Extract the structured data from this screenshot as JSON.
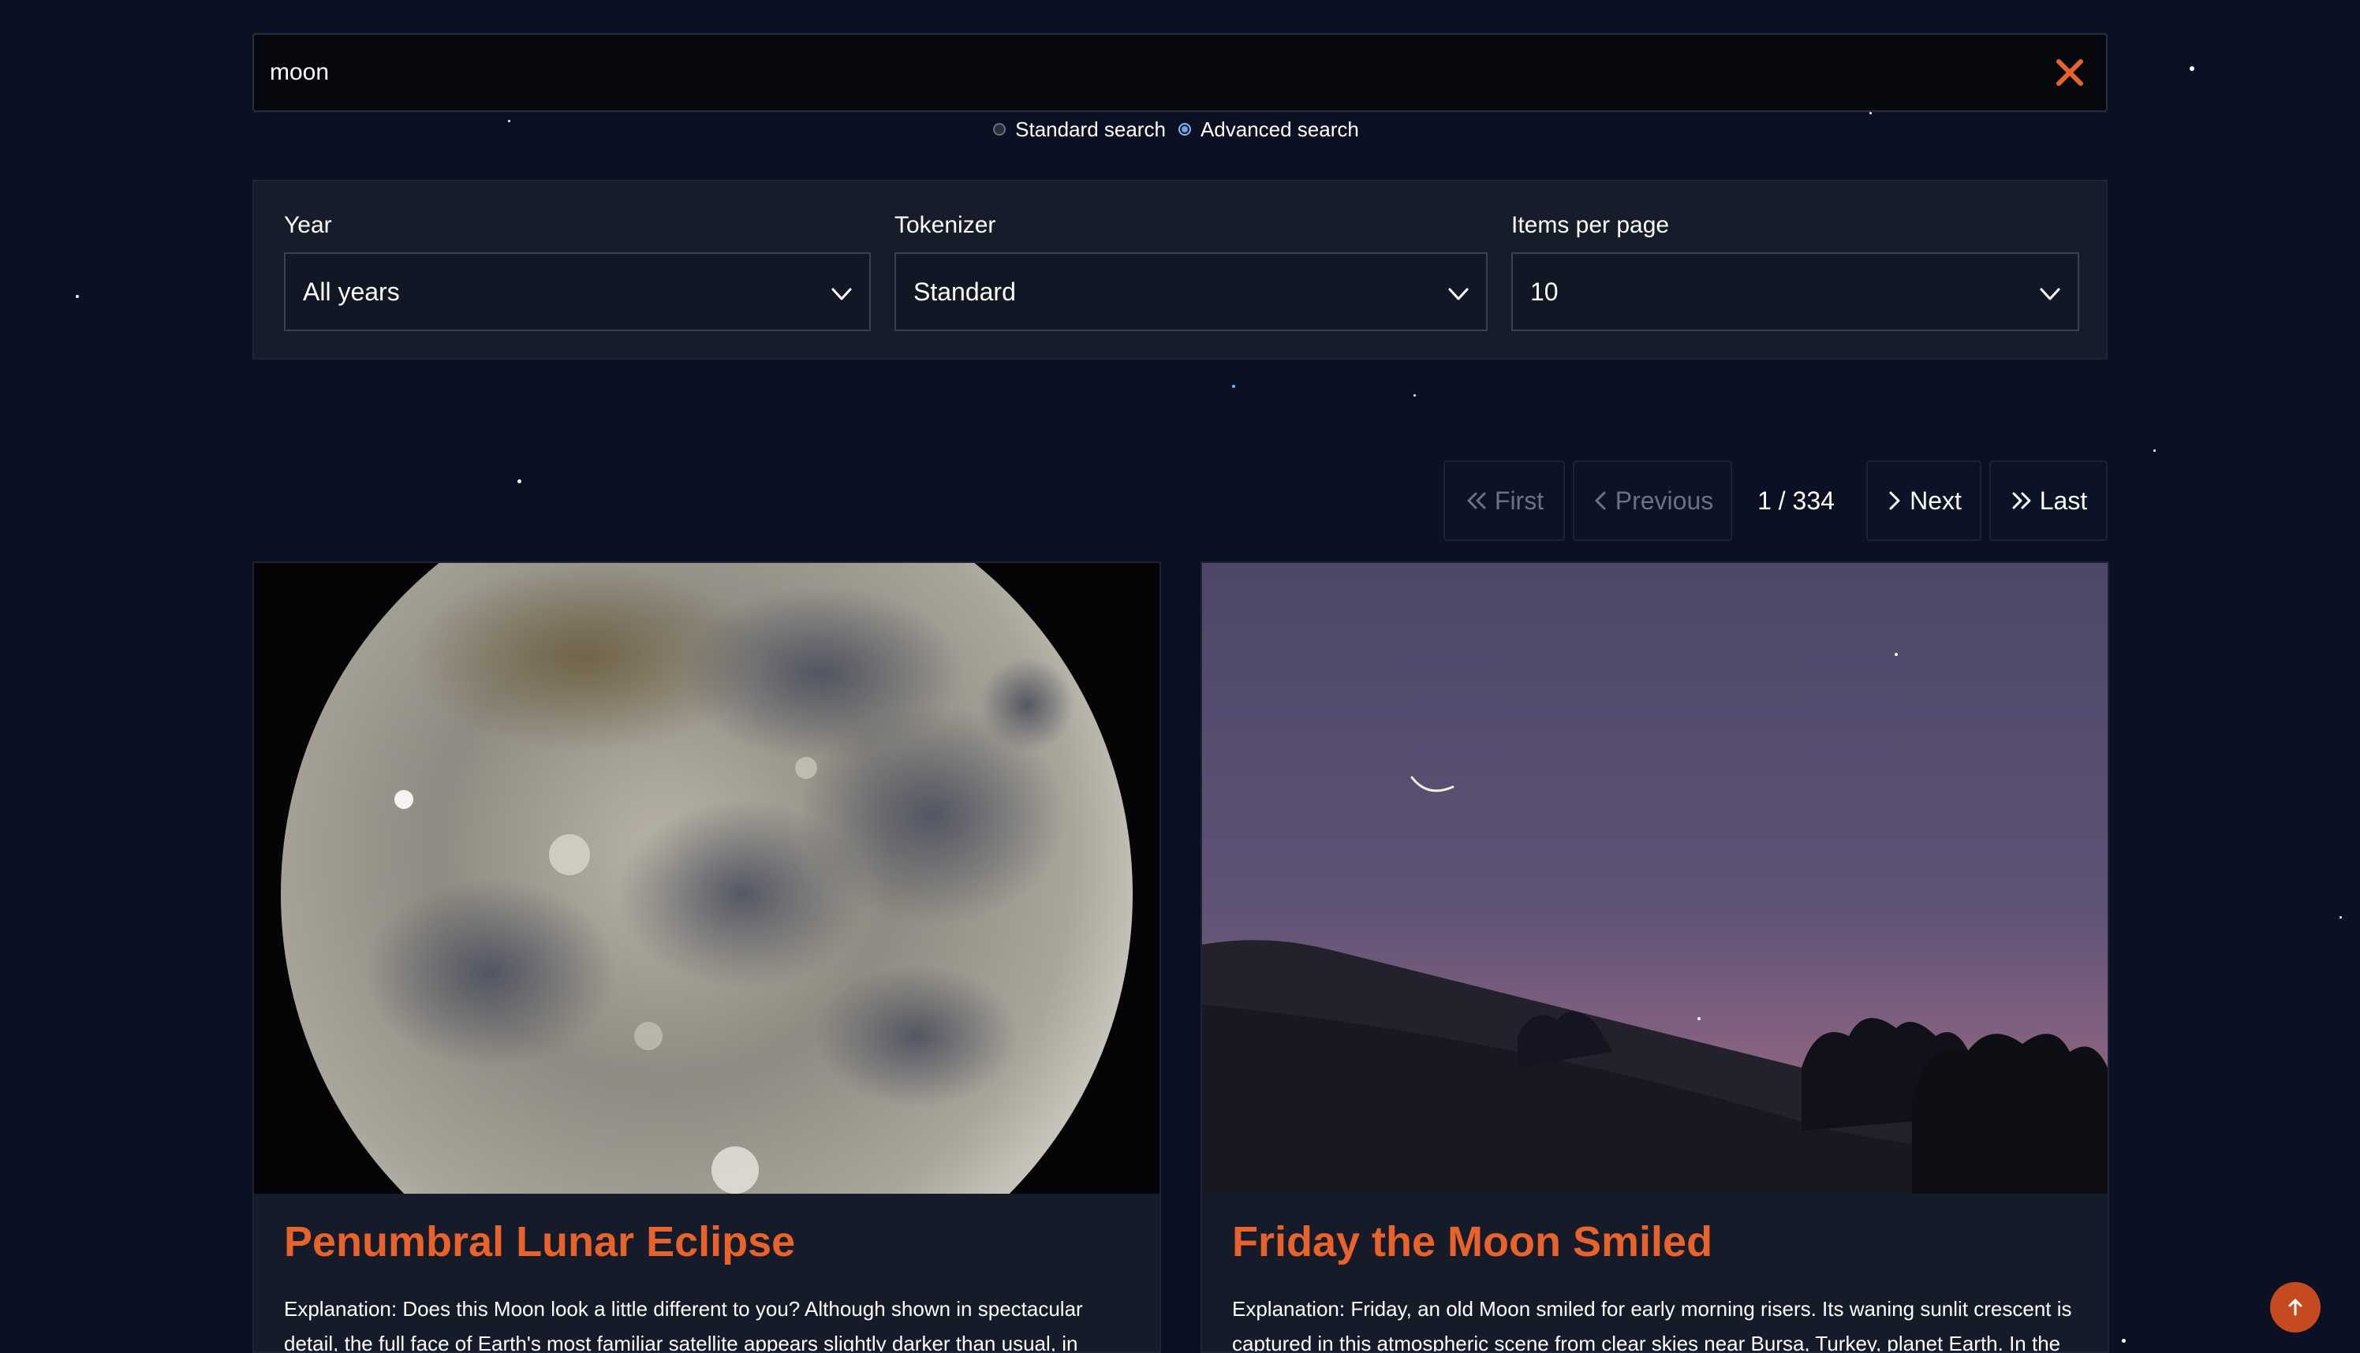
{
  "search": {
    "value": "moon",
    "clear_icon": "close-icon",
    "modes": [
      {
        "label": "Standard search",
        "checked": false
      },
      {
        "label": "Advanced search",
        "checked": true
      }
    ]
  },
  "filters": {
    "year": {
      "label": "Year",
      "selected": "All years"
    },
    "tokenizer": {
      "label": "Tokenizer",
      "selected": "Standard"
    },
    "items_per_page": {
      "label": "Items per page",
      "selected": "10"
    }
  },
  "pagination": {
    "first_label": "First",
    "previous_label": "Previous",
    "indicator": "1 / 334",
    "next_label": "Next",
    "last_label": "Last"
  },
  "results": [
    {
      "title": "Penumbral Lunar Eclipse",
      "explanation": "Explanation: Does this Moon look a little different to you? Although shown in spectacular detail, the full face of Earth's most familiar satellite appears slightly darker than usual, in particular on"
    },
    {
      "title": "Friday the Moon Smiled",
      "explanation": "Explanation: Friday, an old Moon smiled for early morning risers. Its waning sunlit crescent is captured in this atmospheric scene from clear skies near Bursa, Turkey, planet Earth. In the"
    }
  ],
  "colors": {
    "background": "#0b1123",
    "accent": "#e8632b",
    "panel": "#171c2b"
  }
}
